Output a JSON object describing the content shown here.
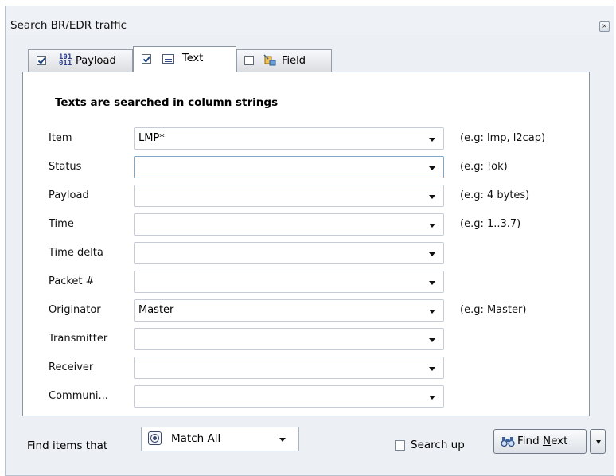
{
  "window": {
    "title": "Search BR/EDR traffic",
    "close_glyph": "×"
  },
  "tabs": [
    {
      "label": "Payload",
      "checked": true,
      "icon": "binary-icon",
      "icon_text_top": "101",
      "icon_text_bottom": "011"
    },
    {
      "label": "Text",
      "checked": true,
      "icon": "text-field-icon",
      "active": true
    },
    {
      "label": "Field",
      "checked": false,
      "icon": "field-icon"
    }
  ],
  "text_tab": {
    "heading": "Texts are searched in column strings",
    "rows": [
      {
        "label": "Item",
        "value": "LMP*",
        "hint": "(e.g: lmp, l2cap)"
      },
      {
        "label": "Status",
        "value": "",
        "hint": "(e.g: !ok)",
        "focused": true
      },
      {
        "label": "Payload",
        "value": "",
        "hint": "(e.g: 4 bytes)"
      },
      {
        "label": "Time",
        "value": "",
        "hint": "(e.g: 1..3.7)"
      },
      {
        "label": "Time delta",
        "value": "",
        "hint": ""
      },
      {
        "label": "Packet #",
        "value": "",
        "hint": ""
      },
      {
        "label": "Originator",
        "value": "Master",
        "hint": "(e.g: Master)"
      },
      {
        "label": "Transmitter",
        "value": "",
        "hint": ""
      },
      {
        "label": "Receiver",
        "value": "",
        "hint": ""
      },
      {
        "label": "Communi...",
        "value": "",
        "hint": ""
      }
    ]
  },
  "footer": {
    "find_label": "Find items that",
    "match_mode": "Match All",
    "search_up_label": "Search up",
    "search_up_checked": false,
    "find_next_prefix": "Find ",
    "find_next_mnemonic": "N",
    "find_next_suffix": "ext"
  },
  "colors": {
    "panel_bg": "#ffffff",
    "window_bg": "#eceff3",
    "check_mark": "#21467e"
  }
}
